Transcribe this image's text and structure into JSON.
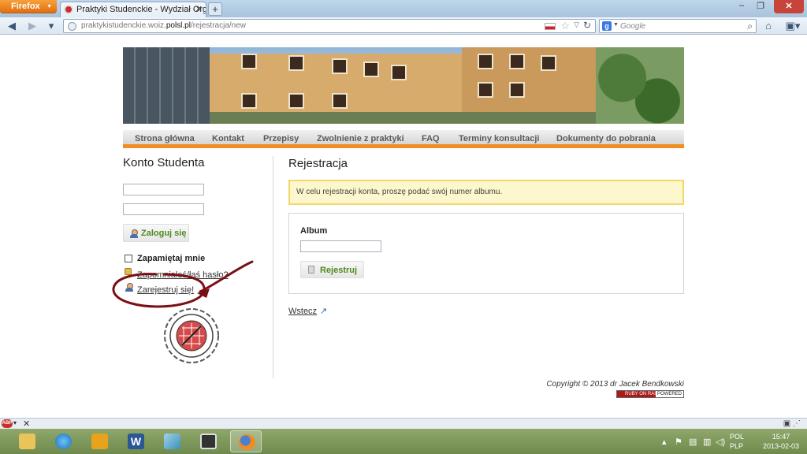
{
  "browser": {
    "app_button": "Firefox",
    "tab_title": "Praktyki Studenckie - Wydział Organizacji...",
    "url_prefix": "praktykistudenckie.woiz.",
    "url_domain": "polsl.pl",
    "url_path": "/rejestracja/new",
    "search_placeholder": "Google"
  },
  "site": {
    "menu": [
      "Strona główna",
      "Kontakt",
      "Przepisy",
      "Zwolnienie z praktyki",
      "FAQ",
      "Terminy konsultacji",
      "Dokumenty do pobrania"
    ],
    "accent_color": "#f08c21"
  },
  "sidebar": {
    "title": "Konto Studenta",
    "login_button": "Zaloguj się",
    "remember_label": "Zapamiętaj mnie",
    "forgot_link": "Zapomniałeś/łaś hasło?",
    "register_link": "Zarejestruj się!"
  },
  "main": {
    "title": "Rejestracja",
    "notice": "W celu rejestracji konta, proszę podać swój numer albumu.",
    "album_label": "Album",
    "register_button": "Rejestruj",
    "back_link": "Wstecz"
  },
  "footer": {
    "copyright": "Copyright © 2013 dr Jacek Bendkowski",
    "badge_left": "RUBY ON RAILS",
    "badge_right": "POWERED"
  },
  "taskbar": {
    "language": "POL",
    "layout": "PLP",
    "time": "15:47",
    "date": "2013-02-03"
  }
}
